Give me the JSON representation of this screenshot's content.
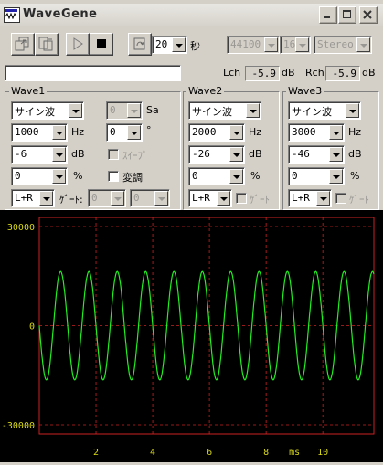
{
  "window": {
    "title": "WaveGene"
  },
  "toolbar": {
    "duration": "20",
    "duration_unit": "秒",
    "sample_rate": "44100",
    "bit_depth": "16",
    "channels": "Stereo",
    "status_text": ""
  },
  "levels": {
    "lch_label": "Lch",
    "lch_value": "-5.9",
    "rch_label": "Rch",
    "rch_value": "-5.9",
    "unit": "dB"
  },
  "wave1": {
    "title": "Wave1",
    "waveform": "サイン波",
    "frequency": "1000",
    "freq_unit": "Hz",
    "level": "-6",
    "level_unit": "dB",
    "offset": "0",
    "offset_unit": "%",
    "channel": "L+R",
    "sa_value": "0",
    "sa_label": "Sa",
    "phase": "0",
    "phase_unit": "°",
    "sweep_label": "ｽｲｰﾌﾟ",
    "mod_label": "変調",
    "gate_label": "ｹﾞｰﾄ:",
    "gate1": "0",
    "gate2": "0"
  },
  "wave2": {
    "title": "Wave2",
    "waveform": "サイン波",
    "frequency": "2000",
    "freq_unit": "Hz",
    "level": "-26",
    "level_unit": "dB",
    "offset": "0",
    "offset_unit": "%",
    "channel": "L+R",
    "gate_label": "ｹﾞｰﾄ"
  },
  "wave3": {
    "title": "Wave3",
    "waveform": "サイン波",
    "frequency": "3000",
    "freq_unit": "Hz",
    "level": "-46",
    "level_unit": "dB",
    "offset": "0",
    "offset_unit": "%",
    "channel": "L+R",
    "gate_label": "ｹﾞｰﾄ"
  },
  "colors": {
    "trace": "#22ee22",
    "grid": "#cc2222",
    "axis_text": "#d8d818",
    "background": "#000000"
  },
  "chart_data": {
    "type": "line",
    "title": "",
    "xlabel": "ms",
    "ylabel": "",
    "x_ticks": [
      "2",
      "4",
      "6",
      "8",
      "10"
    ],
    "y_ticks": [
      "30000",
      "0",
      "-30000"
    ],
    "xlim": [
      0,
      11.8
    ],
    "ylim": [
      -32768,
      32768
    ],
    "grid": true,
    "series": [
      {
        "frequency_hz": 1000,
        "amplitude": 16400,
        "waveform": "sine"
      }
    ]
  }
}
